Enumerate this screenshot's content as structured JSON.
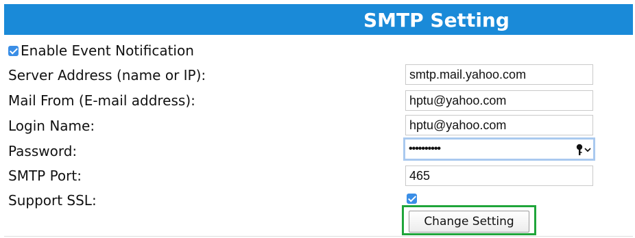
{
  "header": {
    "title": "SMTP Setting"
  },
  "enable_notification": {
    "label": "Enable Event Notification",
    "checked": true
  },
  "server_address": {
    "label": "Server Address (name or IP):",
    "value": "smtp.mail.yahoo.com"
  },
  "mail_from": {
    "label": "Mail From (E-mail address):",
    "value": "hptu@yahoo.com"
  },
  "login_name": {
    "label": "Login Name:",
    "value": "hptu@yahoo.com"
  },
  "password": {
    "label": "Password:",
    "value": "••••••••••",
    "icons": [
      "key-icon",
      "chevron-down-icon"
    ]
  },
  "smtp_port": {
    "label": "SMTP Port:",
    "value": "465"
  },
  "support_ssl": {
    "label": "Support SSL:",
    "checked": true
  },
  "submit": {
    "label": "Change Setting"
  },
  "colors": {
    "header_bg": "#1a8ad8",
    "checkbox": "#3a8ee6",
    "button_highlight": "#1fa53a",
    "focus_ring": "#a9c9ef"
  }
}
